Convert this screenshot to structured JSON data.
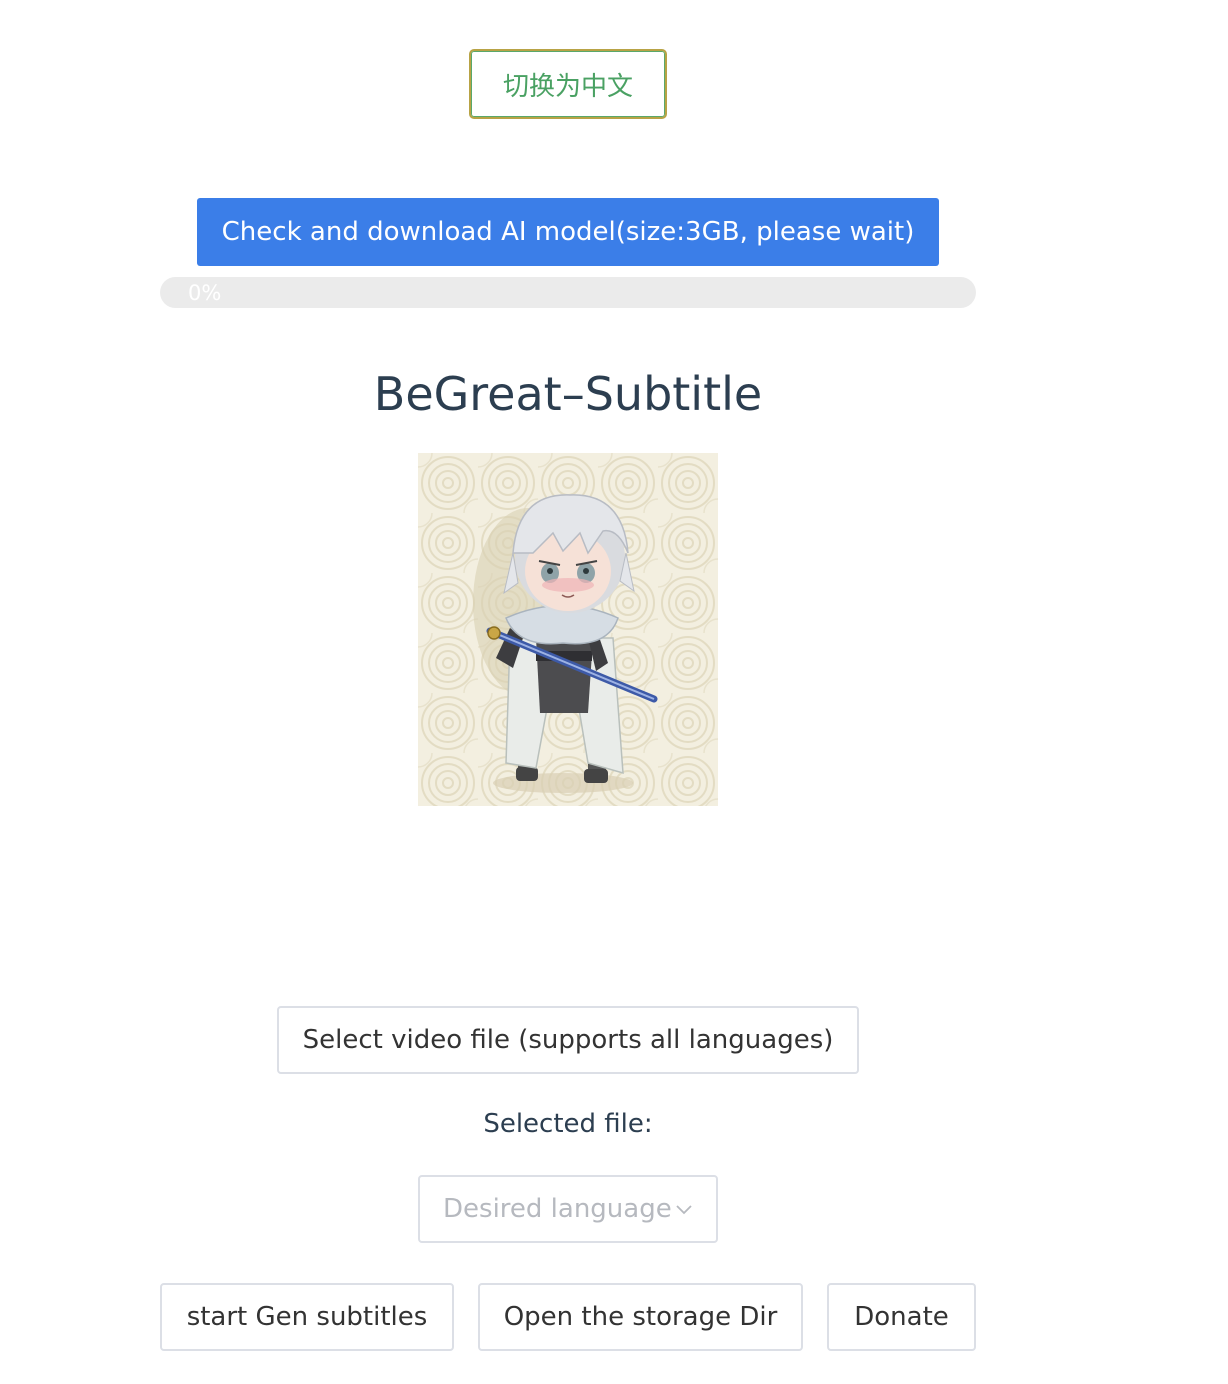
{
  "header": {
    "language_toggle_label": "切换为中文"
  },
  "model": {
    "download_button_label": "Check and download AI model(size:3GB, please wait)",
    "progress_text": "0%",
    "progress_fraction": 0
  },
  "app": {
    "title": "BeGreat–Subtitle"
  },
  "actions": {
    "select_video_label": "Select video file (supports all languages)",
    "selected_file_label": "Selected file:",
    "language_select_placeholder": "Desired language",
    "start_label": "start Gen subtitles",
    "open_storage_label": "Open the storage Dir",
    "donate_label": "Donate"
  },
  "colors": {
    "primary": "#3b7ee8",
    "toggle_text": "#4aa163",
    "title_text": "#2c3e50"
  }
}
